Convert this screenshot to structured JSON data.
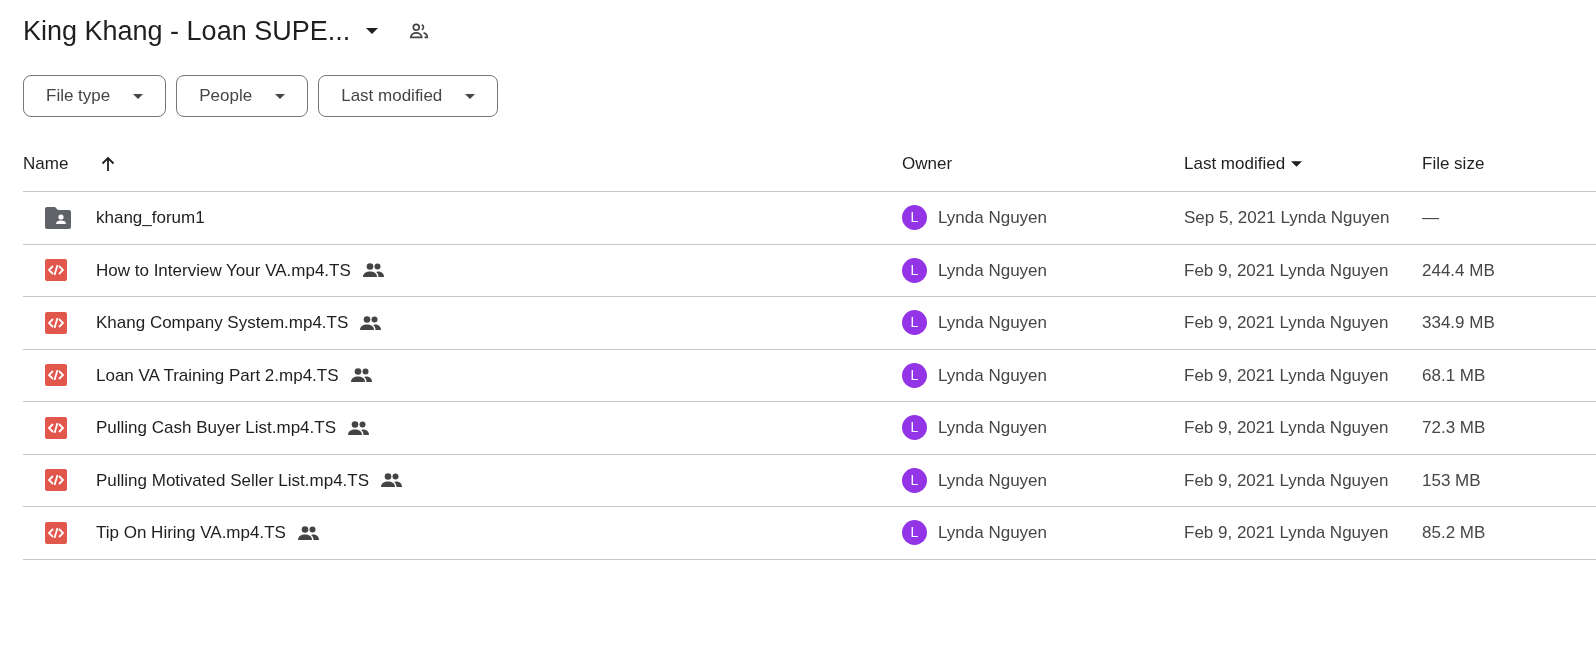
{
  "title": "King Khang - Loan SUPE...",
  "filters": [
    "File type",
    "People",
    "Last modified"
  ],
  "columns": [
    "Name",
    "Owner",
    "Last modified",
    "File size"
  ],
  "rows": [
    {
      "kind": "folder",
      "name": "khang_forum1",
      "shared": false,
      "avatar": "L",
      "owner": "Lynda Nguyen",
      "modified": "Sep 5, 2021 Lynda Nguyen",
      "size": "—"
    },
    {
      "kind": "video",
      "name": "How to Interview Your VA.mp4.TS",
      "shared": true,
      "avatar": "L",
      "owner": "Lynda Nguyen",
      "modified": "Feb 9, 2021 Lynda Nguyen",
      "size": "244.4 MB"
    },
    {
      "kind": "video",
      "name": "Khang Company System.mp4.TS",
      "shared": true,
      "avatar": "L",
      "owner": "Lynda Nguyen",
      "modified": "Feb 9, 2021 Lynda Nguyen",
      "size": "334.9 MB"
    },
    {
      "kind": "video",
      "name": "Loan VA Training Part 2.mp4.TS",
      "shared": true,
      "avatar": "L",
      "owner": "Lynda Nguyen",
      "modified": "Feb 9, 2021 Lynda Nguyen",
      "size": "68.1 MB"
    },
    {
      "kind": "video",
      "name": "Pulling Cash Buyer List.mp4.TS",
      "shared": true,
      "avatar": "L",
      "owner": "Lynda Nguyen",
      "modified": "Feb 9, 2021 Lynda Nguyen",
      "size": "72.3 MB"
    },
    {
      "kind": "video",
      "name": "Pulling Motivated Seller List.mp4.TS",
      "shared": true,
      "avatar": "L",
      "owner": "Lynda Nguyen",
      "modified": "Feb 9, 2021 Lynda Nguyen",
      "size": "153 MB"
    },
    {
      "kind": "video",
      "name": "Tip On Hiring VA.mp4.TS",
      "shared": true,
      "avatar": "L",
      "owner": "Lynda Nguyen",
      "modified": "Feb 9, 2021 Lynda Nguyen",
      "size": "85.2 MB"
    }
  ]
}
